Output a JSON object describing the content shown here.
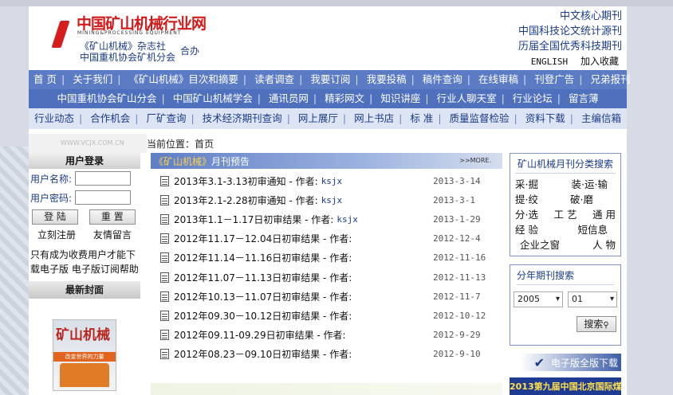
{
  "header": {
    "logo_cn": "中国矿山机械行业网",
    "logo_en": "MINING&PROCESSING EQUIPMENT",
    "org_line1": "《矿山机械》杂志社",
    "org_line2": "中国重机协会矿机分会",
    "org_suffix": "合办",
    "badges": [
      "中文核心期刊",
      "中国科技论文统计源刊",
      "历届全国优秀科技期刊"
    ],
    "english_link": "ENGLISH",
    "favorite_link": "加入收藏"
  },
  "nav": {
    "row1": [
      "首 页",
      "关于我们",
      "《矿山机械》目次和摘要",
      "读者调查",
      "我要订阅",
      "我要投稿",
      "稿件查询",
      "在线审稿",
      "刊登广告",
      "兄弟报刊"
    ],
    "row2": [
      "中国重机协会矿山分会",
      "中国矿山机械学会",
      "通讯员网",
      "精彩网文",
      "知识讲座",
      "行业人聊天室",
      "行业论坛",
      "留言薄"
    ],
    "row3": [
      "行业动态",
      "合作机会",
      "厂矿查询",
      "技术经济期刊查询",
      "网上展厅",
      "网上书店",
      "标 准",
      "质量监督检验",
      "资料下载",
      "主编信箱"
    ]
  },
  "banner_text": "WWW.VCJX.COM.CN",
  "breadcrumb": "当前位置：首页",
  "login": {
    "title": "用户登录",
    "username_label": "用户名称:",
    "password_label": "用户密码:",
    "login_button": "登 陆",
    "reset_button": "重 置",
    "register_link": "立刻注册",
    "message_link": "友情留言",
    "note_line1": "只有成为收费用户才能下",
    "note_line2a": "载电子版",
    "note_line2b": "电子版订阅帮助"
  },
  "cover": {
    "title": "最新封面",
    "magazine_name": "矿山机械",
    "band_text": "改变世界的力量"
  },
  "forecast": {
    "title_pre": "《矿山机械》",
    "title_post": "月刊预告",
    "more": ">>MORE.",
    "items": [
      {
        "title": "2013年3.1-3.13初审通知 - 作者:",
        "author": "ksjx",
        "date": "2013-3-14"
      },
      {
        "title": "2013年2.1-2.28初审通知 - 作者:",
        "author": "ksjx",
        "date": "2013-3-1"
      },
      {
        "title": "2013年1.1－1.17日初审结果 - 作者:",
        "author": "ksjx",
        "date": "2013-1-29"
      },
      {
        "title": "2012年11.17－12.04日初审结果 - 作者:",
        "author": "",
        "date": "2012-12-4"
      },
      {
        "title": "2012年11.14－11.16日初审结果 - 作者:",
        "author": "",
        "date": "2012-11-16"
      },
      {
        "title": "2012年11.07－11.13日初审结果 - 作者:",
        "author": "",
        "date": "2012-11-13"
      },
      {
        "title": "2012年10.13－11.07日初审结果 - 作者:",
        "author": "",
        "date": "2012-11-7"
      },
      {
        "title": "2012年09.30－10.12日初审结果 - 作者:",
        "author": "",
        "date": "2012-10-12"
      },
      {
        "title": "2012年09.11-09.29日初审结果 - 作者:",
        "author": "",
        "date": "2012-9-29"
      },
      {
        "title": "2012年08.23－09.10日初审结果 - 作者:",
        "author": "",
        "date": "2012-9-10"
      }
    ]
  },
  "categories": {
    "title": "矿山机械月刊分类搜索",
    "rows": [
      [
        "采·掘",
        "装·运·输"
      ],
      [
        "提·绞",
        "破·磨"
      ],
      [
        "分·选",
        "工 艺",
        "通 用"
      ],
      [
        "经 验",
        "短信息"
      ],
      [
        "企业之窗",
        "人 物"
      ]
    ]
  },
  "issue_search": {
    "title": "分年期刊搜索",
    "year": "2005",
    "issue": "01",
    "button": "搜索"
  },
  "download_label": "电子版全版下载",
  "expo_text": "2013第九届中国北京国际煤",
  "colors": {
    "nav_blue": "#5b7bc4",
    "brand_red": "#d21a1a",
    "link_blue": "#1a3b8a"
  }
}
